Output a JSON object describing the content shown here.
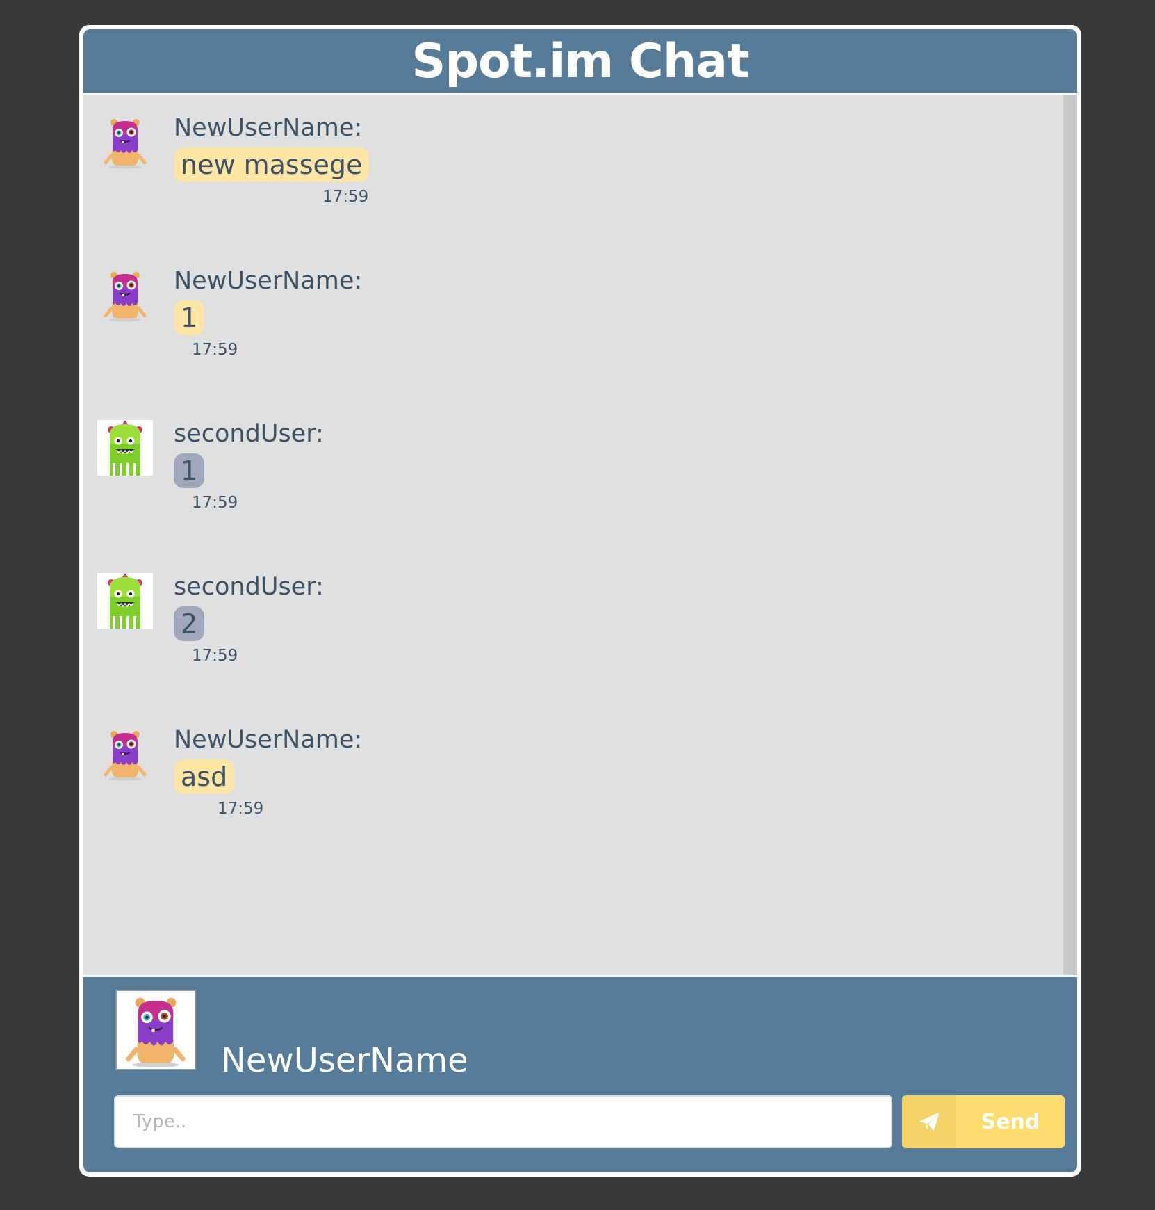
{
  "header": {
    "title": "Spot.im Chat"
  },
  "messages": [
    {
      "user": "NewUserName:",
      "text": "new massege",
      "time": "17:59",
      "kind": "me"
    },
    {
      "user": "NewUserName:",
      "text": "1",
      "time": "17:59",
      "kind": "me"
    },
    {
      "user": "secondUser:",
      "text": "1",
      "time": "17:59",
      "kind": "other"
    },
    {
      "user": "secondUser:",
      "text": "2",
      "time": "17:59",
      "kind": "other"
    },
    {
      "user": "NewUserName:",
      "text": "asd",
      "time": "17:59",
      "kind": "me"
    }
  ],
  "composer": {
    "current_user": "NewUserName",
    "placeholder": "Type..",
    "send_label": "Send",
    "send_icon": "paper-plane-icon"
  },
  "colors": {
    "background": "#3a383a",
    "header": "#557b99",
    "my_bubble": "#ffe6a6",
    "other_bubble": "#a3a7bc",
    "send_button": "#fedb6d"
  }
}
